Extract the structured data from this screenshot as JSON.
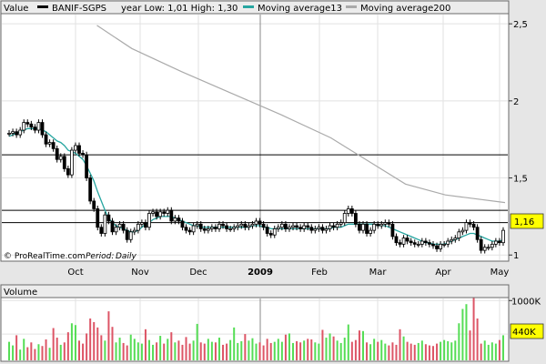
{
  "chart_data": [
    {
      "type": "candlestick",
      "legend": [
        {
          "label": "Value",
          "color": ""
        },
        {
          "label": "BANIF-SGPS",
          "color": "#000000"
        },
        {
          "label": "year Low: 1,01 High: 1,30",
          "color": ""
        },
        {
          "label": "Moving average13",
          "color": "#26a5a0"
        },
        {
          "label": "Moving average200",
          "color": "#aaaaaa"
        }
      ],
      "footer": {
        "source": "© ProRealTime.com",
        "period_label": "Period:",
        "period_value": "Daily"
      },
      "y_ticks": [
        {
          "v": 1,
          "label": "1"
        },
        {
          "v": 1.5,
          "label": "1,5"
        },
        {
          "v": 2,
          "label": "2"
        },
        {
          "v": 2.5,
          "label": "2,5"
        }
      ],
      "ylim": [
        0.96,
        2.56
      ],
      "x_ticks": [
        {
          "label": "Oct",
          "bold": false
        },
        {
          "label": "Nov",
          "bold": false
        },
        {
          "label": "Dec",
          "bold": false
        },
        {
          "label": "2009",
          "bold": true
        },
        {
          "label": "Feb",
          "bold": false
        },
        {
          "label": "Mar",
          "bold": false
        },
        {
          "label": "Apr",
          "bold": false
        },
        {
          "label": "May",
          "bold": false
        }
      ],
      "horizontal_lines": [
        1.65,
        1.29,
        1.21
      ],
      "last_value_label": "1,16",
      "close_series": [
        1.79,
        1.8,
        1.78,
        1.81,
        1.86,
        1.85,
        1.83,
        1.81,
        1.86,
        1.78,
        1.72,
        1.73,
        1.69,
        1.62,
        1.64,
        1.56,
        1.52,
        1.68,
        1.71,
        1.66,
        1.65,
        1.5,
        1.35,
        1.3,
        1.18,
        1.14,
        1.26,
        1.22,
        1.15,
        1.18,
        1.2,
        1.16,
        1.1,
        1.15,
        1.16,
        1.2,
        1.21,
        1.18,
        1.27,
        1.28,
        1.25,
        1.28,
        1.27,
        1.29,
        1.22,
        1.24,
        1.22,
        1.18,
        1.16,
        1.15,
        1.19,
        1.2,
        1.17,
        1.16,
        1.17,
        1.18,
        1.17,
        1.2,
        1.19,
        1.17,
        1.17,
        1.18,
        1.19,
        1.2,
        1.18,
        1.19,
        1.2,
        1.22,
        1.2,
        1.18,
        1.14,
        1.13,
        1.17,
        1.18,
        1.2,
        1.17,
        1.18,
        1.19,
        1.18,
        1.17,
        1.19,
        1.18,
        1.16,
        1.17,
        1.18,
        1.16,
        1.17,
        1.19,
        1.18,
        1.2,
        1.21,
        1.27,
        1.3,
        1.27,
        1.2,
        1.16,
        1.2,
        1.14,
        1.16,
        1.2,
        1.19,
        1.2,
        1.21,
        1.2,
        1.12,
        1.08,
        1.07,
        1.11,
        1.09,
        1.08,
        1.07,
        1.07,
        1.09,
        1.08,
        1.07,
        1.06,
        1.04,
        1.07,
        1.07,
        1.09,
        1.1,
        1.11,
        1.15,
        1.16,
        1.21,
        1.2,
        1.18,
        1.1,
        1.03,
        1.05,
        1.05,
        1.07,
        1.09,
        1.08,
        1.16
      ],
      "ma13_series": [
        1.77,
        1.78,
        1.79,
        1.8,
        1.81,
        1.82,
        1.82,
        1.82,
        1.82,
        1.81,
        1.8,
        1.78,
        1.76,
        1.74,
        1.73,
        1.71,
        1.68,
        1.67,
        1.66,
        1.64,
        1.62,
        1.58,
        1.53,
        1.48,
        1.41,
        1.35,
        1.29,
        1.24,
        1.21,
        1.19,
        1.18,
        1.17,
        1.16,
        1.15,
        1.15,
        1.16,
        1.18,
        1.2,
        1.21,
        1.23,
        1.24,
        1.25,
        1.25,
        1.25,
        1.25,
        1.24,
        1.23,
        1.22,
        1.21,
        1.2,
        1.19,
        1.19,
        1.18,
        1.18,
        1.18,
        1.18,
        1.18,
        1.18,
        1.18,
        1.18,
        1.18,
        1.18,
        1.18,
        1.18,
        1.18,
        1.18,
        1.19,
        1.19,
        1.19,
        1.18,
        1.18,
        1.17,
        1.17,
        1.17,
        1.17,
        1.17,
        1.17,
        1.17,
        1.17,
        1.17,
        1.17,
        1.17,
        1.17,
        1.17,
        1.17,
        1.17,
        1.17,
        1.17,
        1.18,
        1.18,
        1.18,
        1.19,
        1.2,
        1.2,
        1.2,
        1.2,
        1.2,
        1.2,
        1.2,
        1.2,
        1.19,
        1.19,
        1.19,
        1.18,
        1.17,
        1.16,
        1.15,
        1.14,
        1.13,
        1.12,
        1.11,
        1.1,
        1.09,
        1.08,
        1.08,
        1.07,
        1.07,
        1.07,
        1.07,
        1.08,
        1.09,
        1.1,
        1.11,
        1.12,
        1.13,
        1.14,
        1.14,
        1.13,
        1.12,
        1.11,
        1.1,
        1.09,
        1.09,
        1.09,
        1.1
      ],
      "ma200_series": [
        [
          0.18,
          2.49
        ],
        [
          0.25,
          2.34
        ],
        [
          0.35,
          2.19
        ],
        [
          0.45,
          2.05
        ],
        [
          0.55,
          1.91
        ],
        [
          0.65,
          1.76
        ],
        [
          0.75,
          1.56
        ],
        [
          0.8,
          1.46
        ],
        [
          0.88,
          1.39
        ],
        [
          1.0,
          1.34
        ]
      ],
      "volume": {
        "title": "Volume",
        "ticks": [
          {
            "v": 1000,
            "label": "1000K"
          },
          {
            "v": 440,
            "label": "440K"
          }
        ],
        "last_value_label": "440K",
        "max": 1050,
        "values": [
          310,
          250,
          420,
          180,
          360,
          220,
          300,
          190,
          270,
          240,
          350,
          210,
          540,
          380,
          260,
          300,
          470,
          620,
          590,
          330,
          280,
          450,
          700,
          640,
          550,
          420,
          330,
          820,
          560,
          300,
          380,
          290,
          250,
          430,
          360,
          300,
          280,
          520,
          340,
          260,
          300,
          410,
          280,
          360,
          470,
          300,
          330,
          260,
          390,
          280,
          330,
          610,
          300,
          280,
          360,
          310,
          300,
          380,
          260,
          280,
          340,
          550,
          290,
          320,
          440,
          330,
          370,
          280,
          300,
          250,
          360,
          290,
          310,
          360,
          310,
          430,
          450,
          290,
          320,
          300,
          330,
          360,
          350,
          300,
          280,
          510,
          380,
          450,
          400,
          330,
          290,
          380,
          600,
          310,
          340,
          500,
          490,
          300,
          270,
          360,
          310,
          340,
          280,
          250,
          300,
          260,
          520,
          400,
          310,
          280,
          260,
          290,
          330,
          270,
          250,
          240,
          280,
          310,
          340,
          320,
          300,
          330,
          620,
          860,
          940,
          500,
          1050,
          700,
          280,
          330,
          260,
          300,
          280,
          340,
          420
        ],
        "up_color": "#55dd55",
        "down_color": "#dd5566"
      }
    }
  ]
}
